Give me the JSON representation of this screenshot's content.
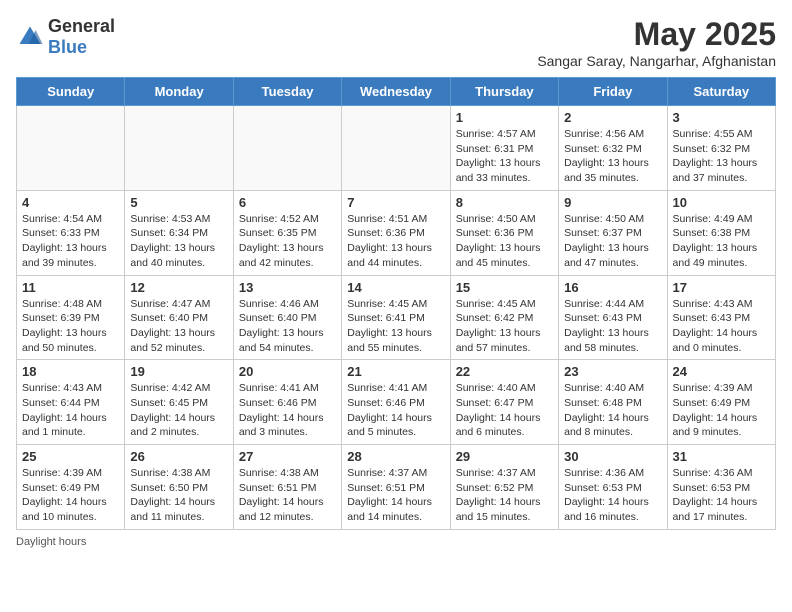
{
  "header": {
    "logo_general": "General",
    "logo_blue": "Blue",
    "month_title": "May 2025",
    "subtitle": "Sangar Saray, Nangarhar, Afghanistan"
  },
  "weekdays": [
    "Sunday",
    "Monday",
    "Tuesday",
    "Wednesday",
    "Thursday",
    "Friday",
    "Saturday"
  ],
  "weeks": [
    [
      {
        "day": "",
        "info": ""
      },
      {
        "day": "",
        "info": ""
      },
      {
        "day": "",
        "info": ""
      },
      {
        "day": "",
        "info": ""
      },
      {
        "day": "1",
        "info": "Sunrise: 4:57 AM\nSunset: 6:31 PM\nDaylight: 13 hours\nand 33 minutes."
      },
      {
        "day": "2",
        "info": "Sunrise: 4:56 AM\nSunset: 6:32 PM\nDaylight: 13 hours\nand 35 minutes."
      },
      {
        "day": "3",
        "info": "Sunrise: 4:55 AM\nSunset: 6:32 PM\nDaylight: 13 hours\nand 37 minutes."
      }
    ],
    [
      {
        "day": "4",
        "info": "Sunrise: 4:54 AM\nSunset: 6:33 PM\nDaylight: 13 hours\nand 39 minutes."
      },
      {
        "day": "5",
        "info": "Sunrise: 4:53 AM\nSunset: 6:34 PM\nDaylight: 13 hours\nand 40 minutes."
      },
      {
        "day": "6",
        "info": "Sunrise: 4:52 AM\nSunset: 6:35 PM\nDaylight: 13 hours\nand 42 minutes."
      },
      {
        "day": "7",
        "info": "Sunrise: 4:51 AM\nSunset: 6:36 PM\nDaylight: 13 hours\nand 44 minutes."
      },
      {
        "day": "8",
        "info": "Sunrise: 4:50 AM\nSunset: 6:36 PM\nDaylight: 13 hours\nand 45 minutes."
      },
      {
        "day": "9",
        "info": "Sunrise: 4:50 AM\nSunset: 6:37 PM\nDaylight: 13 hours\nand 47 minutes."
      },
      {
        "day": "10",
        "info": "Sunrise: 4:49 AM\nSunset: 6:38 PM\nDaylight: 13 hours\nand 49 minutes."
      }
    ],
    [
      {
        "day": "11",
        "info": "Sunrise: 4:48 AM\nSunset: 6:39 PM\nDaylight: 13 hours\nand 50 minutes."
      },
      {
        "day": "12",
        "info": "Sunrise: 4:47 AM\nSunset: 6:40 PM\nDaylight: 13 hours\nand 52 minutes."
      },
      {
        "day": "13",
        "info": "Sunrise: 4:46 AM\nSunset: 6:40 PM\nDaylight: 13 hours\nand 54 minutes."
      },
      {
        "day": "14",
        "info": "Sunrise: 4:45 AM\nSunset: 6:41 PM\nDaylight: 13 hours\nand 55 minutes."
      },
      {
        "day": "15",
        "info": "Sunrise: 4:45 AM\nSunset: 6:42 PM\nDaylight: 13 hours\nand 57 minutes."
      },
      {
        "day": "16",
        "info": "Sunrise: 4:44 AM\nSunset: 6:43 PM\nDaylight: 13 hours\nand 58 minutes."
      },
      {
        "day": "17",
        "info": "Sunrise: 4:43 AM\nSunset: 6:43 PM\nDaylight: 14 hours\nand 0 minutes."
      }
    ],
    [
      {
        "day": "18",
        "info": "Sunrise: 4:43 AM\nSunset: 6:44 PM\nDaylight: 14 hours\nand 1 minute."
      },
      {
        "day": "19",
        "info": "Sunrise: 4:42 AM\nSunset: 6:45 PM\nDaylight: 14 hours\nand 2 minutes."
      },
      {
        "day": "20",
        "info": "Sunrise: 4:41 AM\nSunset: 6:46 PM\nDaylight: 14 hours\nand 3 minutes."
      },
      {
        "day": "21",
        "info": "Sunrise: 4:41 AM\nSunset: 6:46 PM\nDaylight: 14 hours\nand 5 minutes."
      },
      {
        "day": "22",
        "info": "Sunrise: 4:40 AM\nSunset: 6:47 PM\nDaylight: 14 hours\nand 6 minutes."
      },
      {
        "day": "23",
        "info": "Sunrise: 4:40 AM\nSunset: 6:48 PM\nDaylight: 14 hours\nand 8 minutes."
      },
      {
        "day": "24",
        "info": "Sunrise: 4:39 AM\nSunset: 6:49 PM\nDaylight: 14 hours\nand 9 minutes."
      }
    ],
    [
      {
        "day": "25",
        "info": "Sunrise: 4:39 AM\nSunset: 6:49 PM\nDaylight: 14 hours\nand 10 minutes."
      },
      {
        "day": "26",
        "info": "Sunrise: 4:38 AM\nSunset: 6:50 PM\nDaylight: 14 hours\nand 11 minutes."
      },
      {
        "day": "27",
        "info": "Sunrise: 4:38 AM\nSunset: 6:51 PM\nDaylight: 14 hours\nand 12 minutes."
      },
      {
        "day": "28",
        "info": "Sunrise: 4:37 AM\nSunset: 6:51 PM\nDaylight: 14 hours\nand 14 minutes."
      },
      {
        "day": "29",
        "info": "Sunrise: 4:37 AM\nSunset: 6:52 PM\nDaylight: 14 hours\nand 15 minutes."
      },
      {
        "day": "30",
        "info": "Sunrise: 4:36 AM\nSunset: 6:53 PM\nDaylight: 14 hours\nand 16 minutes."
      },
      {
        "day": "31",
        "info": "Sunrise: 4:36 AM\nSunset: 6:53 PM\nDaylight: 14 hours\nand 17 minutes."
      }
    ]
  ],
  "footer": {
    "daylight_hours": "Daylight hours"
  }
}
